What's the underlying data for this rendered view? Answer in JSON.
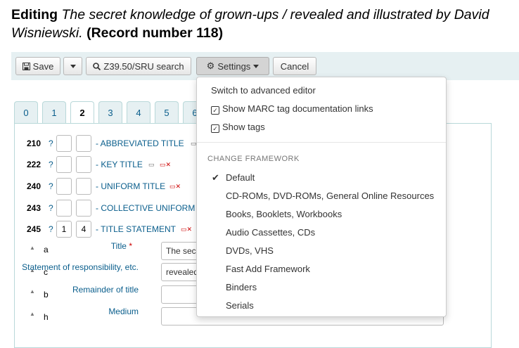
{
  "page": {
    "editing_label": "Editing",
    "record_title": "The secret knowledge of grown-ups / revealed and illustrated by David Wisniewski.",
    "record_number": "(Record number 118)"
  },
  "toolbar": {
    "save_label": "Save",
    "z3950_label": "Z39.50/SRU search",
    "settings_label": "Settings",
    "cancel_label": "Cancel"
  },
  "tabs": [
    "0",
    "1",
    "2",
    "3",
    "4",
    "5",
    "6"
  ],
  "active_tab": "2",
  "fields": [
    {
      "tag": "210",
      "q": "?",
      "ind1": "",
      "ind2": "",
      "title": "- ABBREVIATED TITLE"
    },
    {
      "tag": "222",
      "q": "?",
      "ind1": "",
      "ind2": "",
      "title": "- KEY TITLE"
    },
    {
      "tag": "240",
      "q": "?",
      "ind1": "",
      "ind2": "",
      "title": "- UNIFORM TITLE"
    },
    {
      "tag": "243",
      "q": "?",
      "ind1": "",
      "ind2": "",
      "title": "- COLLECTIVE UNIFORM"
    },
    {
      "tag": "245",
      "q": "?",
      "ind1": "1",
      "ind2": "4",
      "title": "- TITLE STATEMENT"
    }
  ],
  "subfields": [
    {
      "code": "a",
      "label": "Title",
      "required_mark": "*",
      "value": "The sec"
    },
    {
      "code": "c",
      "label": "Statement of responsibility, etc.",
      "value": "revealed"
    },
    {
      "code": "b",
      "label": "Remainder of title",
      "value": ""
    },
    {
      "code": "h",
      "label": "Medium",
      "value": ""
    }
  ],
  "settings_menu": {
    "switch_editor": "Switch to advanced editor",
    "show_marc_links": "Show MARC tag documentation links",
    "show_tags": "Show tags",
    "change_framework_header": "CHANGE FRAMEWORK",
    "frameworks": [
      {
        "label": "Default",
        "selected": true
      },
      {
        "label": "CD-ROMs, DVD-ROMs, General Online Resources",
        "selected": false
      },
      {
        "label": "Books, Booklets, Workbooks",
        "selected": false
      },
      {
        "label": "Audio Cassettes, CDs",
        "selected": false
      },
      {
        "label": "DVDs, VHS",
        "selected": false
      },
      {
        "label": "Fast Add Framework",
        "selected": false
      },
      {
        "label": "Binders",
        "selected": false
      },
      {
        "label": "Serials",
        "selected": false
      }
    ]
  }
}
